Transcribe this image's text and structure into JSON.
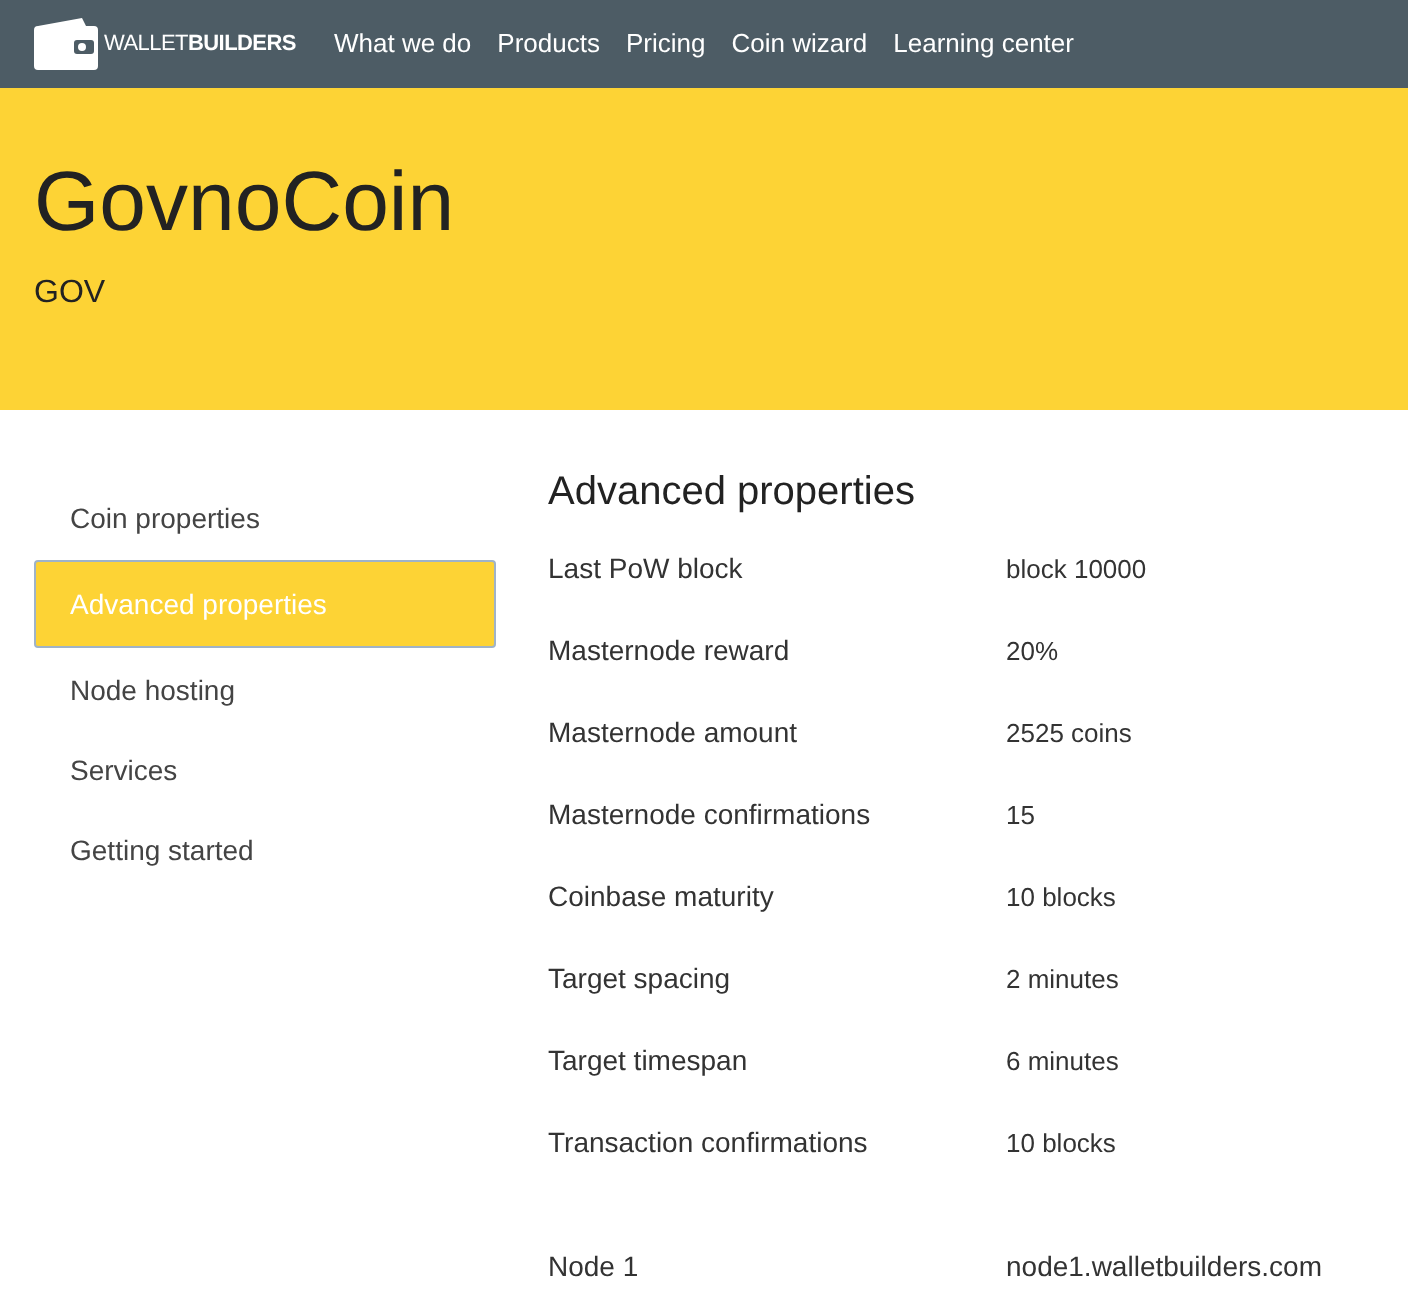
{
  "nav": {
    "logo": "WALLET**BUILDERS**",
    "links": [
      "What we do",
      "Products",
      "Pricing",
      "Coin wizard",
      "Learning center"
    ]
  },
  "hero": {
    "title": "GovnoCoin",
    "ticker": "GOV"
  },
  "sidebar": {
    "items": [
      {
        "label": "Coin properties",
        "selected": false
      },
      {
        "label": "Advanced properties",
        "selected": true
      },
      {
        "label": "Node hosting",
        "selected": false
      },
      {
        "label": "Services",
        "selected": false
      },
      {
        "label": "Getting started",
        "selected": false
      }
    ]
  },
  "content": {
    "heading": "Advanced properties",
    "properties": [
      {
        "label": "Last PoW block",
        "value": "block 10000"
      },
      {
        "label": "Masternode reward",
        "value": "20%"
      },
      {
        "label": "Masternode amount",
        "value": "2525 coins"
      },
      {
        "label": "Masternode confirmations",
        "value": "15"
      },
      {
        "label": "Coinbase maturity",
        "value": "10 blocks"
      },
      {
        "label": "Target spacing",
        "value": "2 minutes"
      },
      {
        "label": "Target timespan",
        "value": "6 minutes"
      },
      {
        "label": "Transaction confirmations",
        "value": "10 blocks"
      }
    ],
    "nodes": [
      {
        "label": "Node 1",
        "value": "node1.walletbuilders.com"
      }
    ]
  }
}
